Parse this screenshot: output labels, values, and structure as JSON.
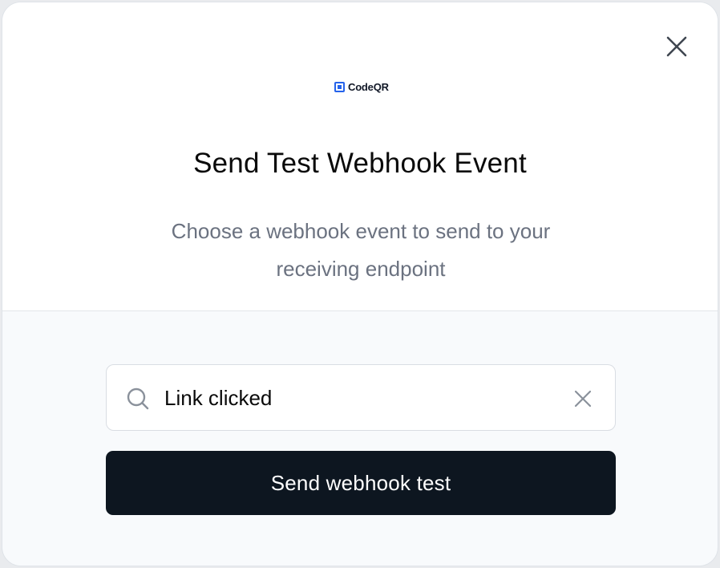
{
  "modal": {
    "brand": "CodeQR",
    "title": "Send Test Webhook Event",
    "subtitle": "Choose a webhook event to send to your receiving endpoint",
    "close_icon": "close-icon"
  },
  "event_select": {
    "value": "Link clicked",
    "search_icon": "search-icon",
    "clear_icon": "clear-icon"
  },
  "actions": {
    "send_label": "Send webhook test"
  },
  "colors": {
    "brand_blue": "#2563eb",
    "button_dark": "#0d1620",
    "subtitle_gray": "#6b7280"
  }
}
